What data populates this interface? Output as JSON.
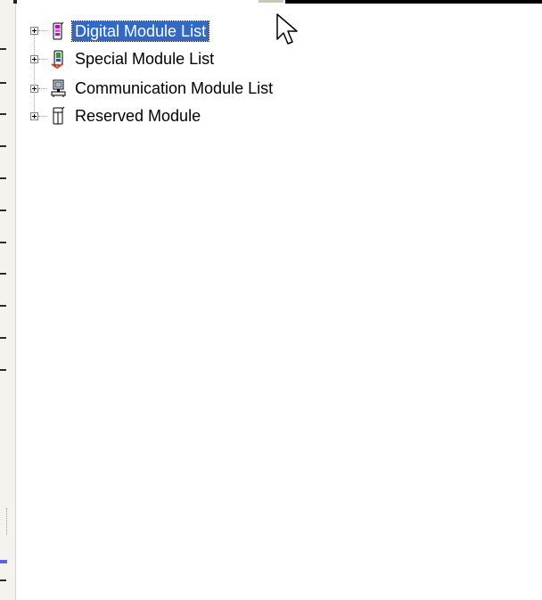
{
  "tree": {
    "items": [
      {
        "label": "Digital Module List",
        "icon": "digital-module-icon",
        "selected": true
      },
      {
        "label": "Special Module List",
        "icon": "special-module-icon",
        "selected": false
      },
      {
        "label": "Communication Module List",
        "icon": "communication-module-icon",
        "selected": false
      },
      {
        "label": "Reserved Module",
        "icon": "reserved-module-icon",
        "selected": false
      }
    ]
  },
  "colors": {
    "selection": "#316ac5",
    "background": "#ffffff",
    "panel_strip": "#f4f3ee"
  },
  "cursor": {
    "icon": "mouse-pointer-icon"
  }
}
